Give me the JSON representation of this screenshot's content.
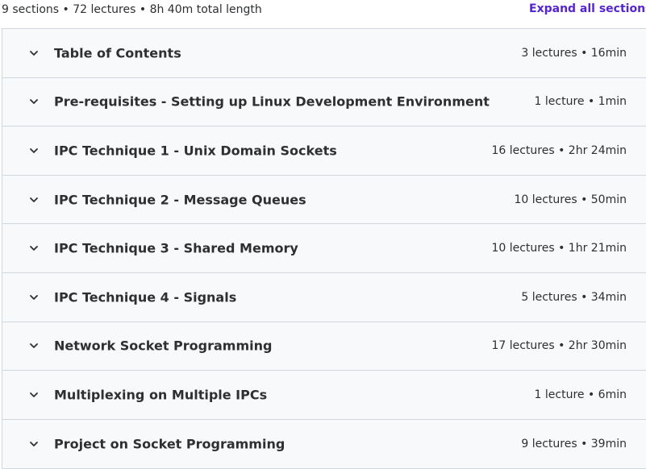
{
  "header": {
    "summary": "9 sections • 72 lectures • 8h 40m total length",
    "expand_all_label": "Expand all sections"
  },
  "sections": [
    {
      "title": "Table of Contents",
      "meta": "3 lectures • 16min"
    },
    {
      "title": "Pre-requisites - Setting up Linux Development Environment",
      "meta": "1 lecture • 1min"
    },
    {
      "title": "IPC Technique 1 - Unix Domain Sockets",
      "meta": "16 lectures • 2hr 24min"
    },
    {
      "title": "IPC Technique 2 - Message Queues",
      "meta": "10 lectures • 50min"
    },
    {
      "title": "IPC Technique 3 - Shared Memory",
      "meta": "10 lectures • 1hr 21min"
    },
    {
      "title": "IPC Technique 4 - Signals",
      "meta": "5 lectures • 34min"
    },
    {
      "title": "Network Socket Programming",
      "meta": "17 lectures • 2hr 30min"
    },
    {
      "title": "Multiplexing on Multiple IPCs",
      "meta": "1 lecture • 6min"
    },
    {
      "title": "Project on Socket Programming",
      "meta": "9 lectures • 39min"
    }
  ],
  "icons": {
    "chevron": "chevron-down-icon"
  },
  "colors": {
    "accent": "#5624d0",
    "row_background": "#f7f9fa",
    "border": "#d1d7dc",
    "text": "#2d2f31"
  }
}
